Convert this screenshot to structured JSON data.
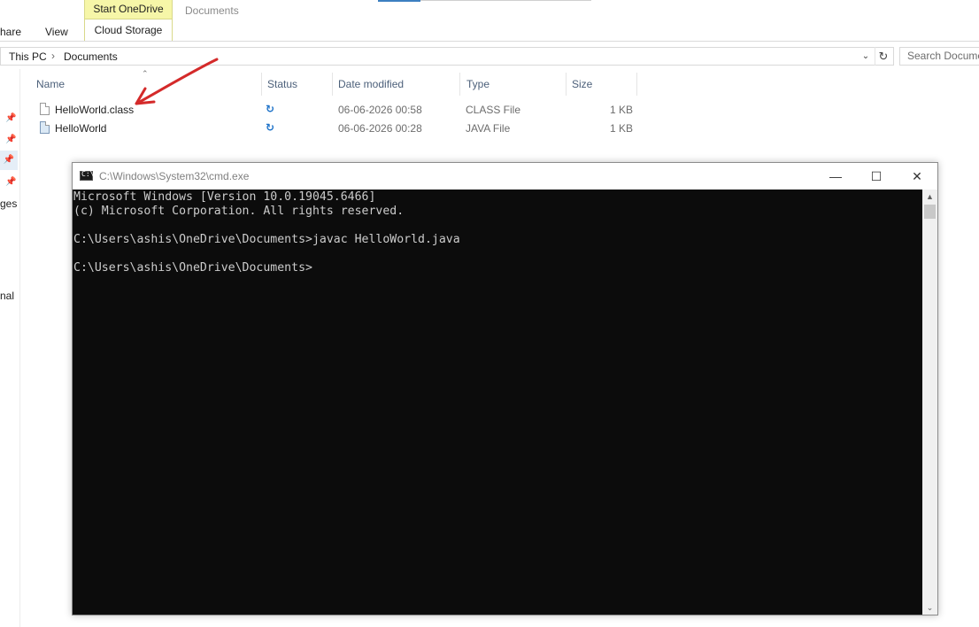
{
  "ribbon": {
    "tabs": [
      "hare",
      "View"
    ],
    "contextual_header": "Start OneDrive",
    "contextual_tab": "Cloud Storage",
    "window_title": "Documents"
  },
  "address_bar": {
    "crumbs": [
      "This PC",
      "Documents"
    ],
    "separator": "›",
    "dropdown_icon": "chevron-down",
    "refresh_icon": "refresh"
  },
  "search": {
    "placeholder": "Search Documents"
  },
  "nav": {
    "fragments": [
      "ges",
      "nal"
    ],
    "pins": [
      "pin",
      "pin",
      "pin",
      "pin"
    ]
  },
  "file_list": {
    "columns": [
      "Name",
      "Status",
      "Date modified",
      "Type",
      "Size"
    ],
    "rows": [
      {
        "name": "HelloWorld.class",
        "status_icon": "sync",
        "date": "06-06-2026 00:58",
        "type": "CLASS File",
        "size": "1 KB"
      },
      {
        "name": "HelloWorld",
        "status_icon": "sync",
        "date": "06-06-2026 00:28",
        "type": "JAVA File",
        "size": "1 KB"
      }
    ]
  },
  "annotation": {
    "color": "#d42a2a"
  },
  "cmd": {
    "title": "C:\\Windows\\System32\\cmd.exe",
    "icon_label": "C:\\",
    "console_text": "Microsoft Windows [Version 10.0.19045.6466]\n(c) Microsoft Corporation. All rights reserved.\n\nC:\\Users\\ashis\\OneDrive\\Documents>javac HelloWorld.java\n\nC:\\Users\\ashis\\OneDrive\\Documents>",
    "buttons": {
      "minimize": "—",
      "maximize": "☐",
      "close": "✕"
    },
    "background": "#0c0c0c",
    "foreground": "#cccccc"
  }
}
